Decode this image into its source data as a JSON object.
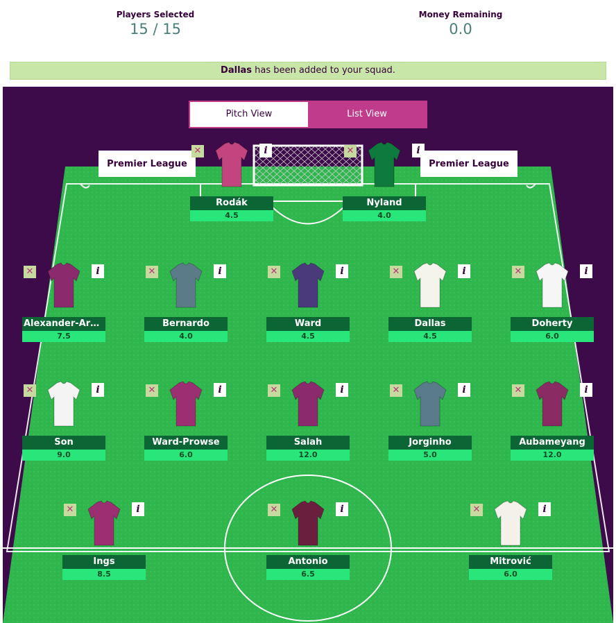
{
  "stats": {
    "players_label": "Players Selected",
    "players_value": "15 / 15",
    "money_label": "Money Remaining",
    "money_value": "0.0"
  },
  "notice": {
    "player": "Dallas",
    "message": " has been added to your squad."
  },
  "toggle": {
    "pitch": "Pitch View",
    "list": "List View"
  },
  "board": {
    "left": "Premier League",
    "right": "Premier League"
  },
  "icons": {
    "remove": "✕",
    "info": "i"
  },
  "colors": {
    "pitch_green": "#2fb64d",
    "purple": "#37003c",
    "accent": "#c03b8b",
    "name_bg": "#0b6535",
    "price_bg": "#28e67a"
  },
  "players": [
    {
      "name": "Rodák",
      "price": "4.5",
      "shirt": "#c2457f",
      "row": "gk"
    },
    {
      "name": "Nyland",
      "price": "4.0",
      "shirt": "#0f7a3d",
      "row": "gk"
    },
    {
      "name": "Alexander-Arno...",
      "price": "7.5",
      "shirt": "#8c2a6e",
      "row": "def"
    },
    {
      "name": "Bernardo",
      "price": "4.0",
      "shirt": "#5b7b88",
      "row": "def"
    },
    {
      "name": "Ward",
      "price": "4.5",
      "shirt": "#4a3a7c",
      "row": "def"
    },
    {
      "name": "Dallas",
      "price": "4.5",
      "shirt": "#f4f4ec",
      "row": "def"
    },
    {
      "name": "Doherty",
      "price": "6.0",
      "shirt": "#f6f6f6",
      "row": "def"
    },
    {
      "name": "Son",
      "price": "9.0",
      "shirt": "#f4f4f4",
      "row": "mid"
    },
    {
      "name": "Ward-Prowse",
      "price": "6.0",
      "shirt": "#9b2f72",
      "row": "mid"
    },
    {
      "name": "Salah",
      "price": "12.0",
      "shirt": "#8c2a6e",
      "row": "mid"
    },
    {
      "name": "Jorginho",
      "price": "5.0",
      "shirt": "#5a7b8a",
      "row": "mid"
    },
    {
      "name": "Aubameyang",
      "price": "12.0",
      "shirt": "#8a2c63",
      "row": "mid"
    },
    {
      "name": "Ings",
      "price": "8.5",
      "shirt": "#9b2f72",
      "row": "fwd"
    },
    {
      "name": "Antonio",
      "price": "6.5",
      "shirt": "#6b1f3f",
      "row": "fwd"
    },
    {
      "name": "Mitrović",
      "price": "6.0",
      "shirt": "#f4f1ea",
      "row": "fwd"
    }
  ]
}
